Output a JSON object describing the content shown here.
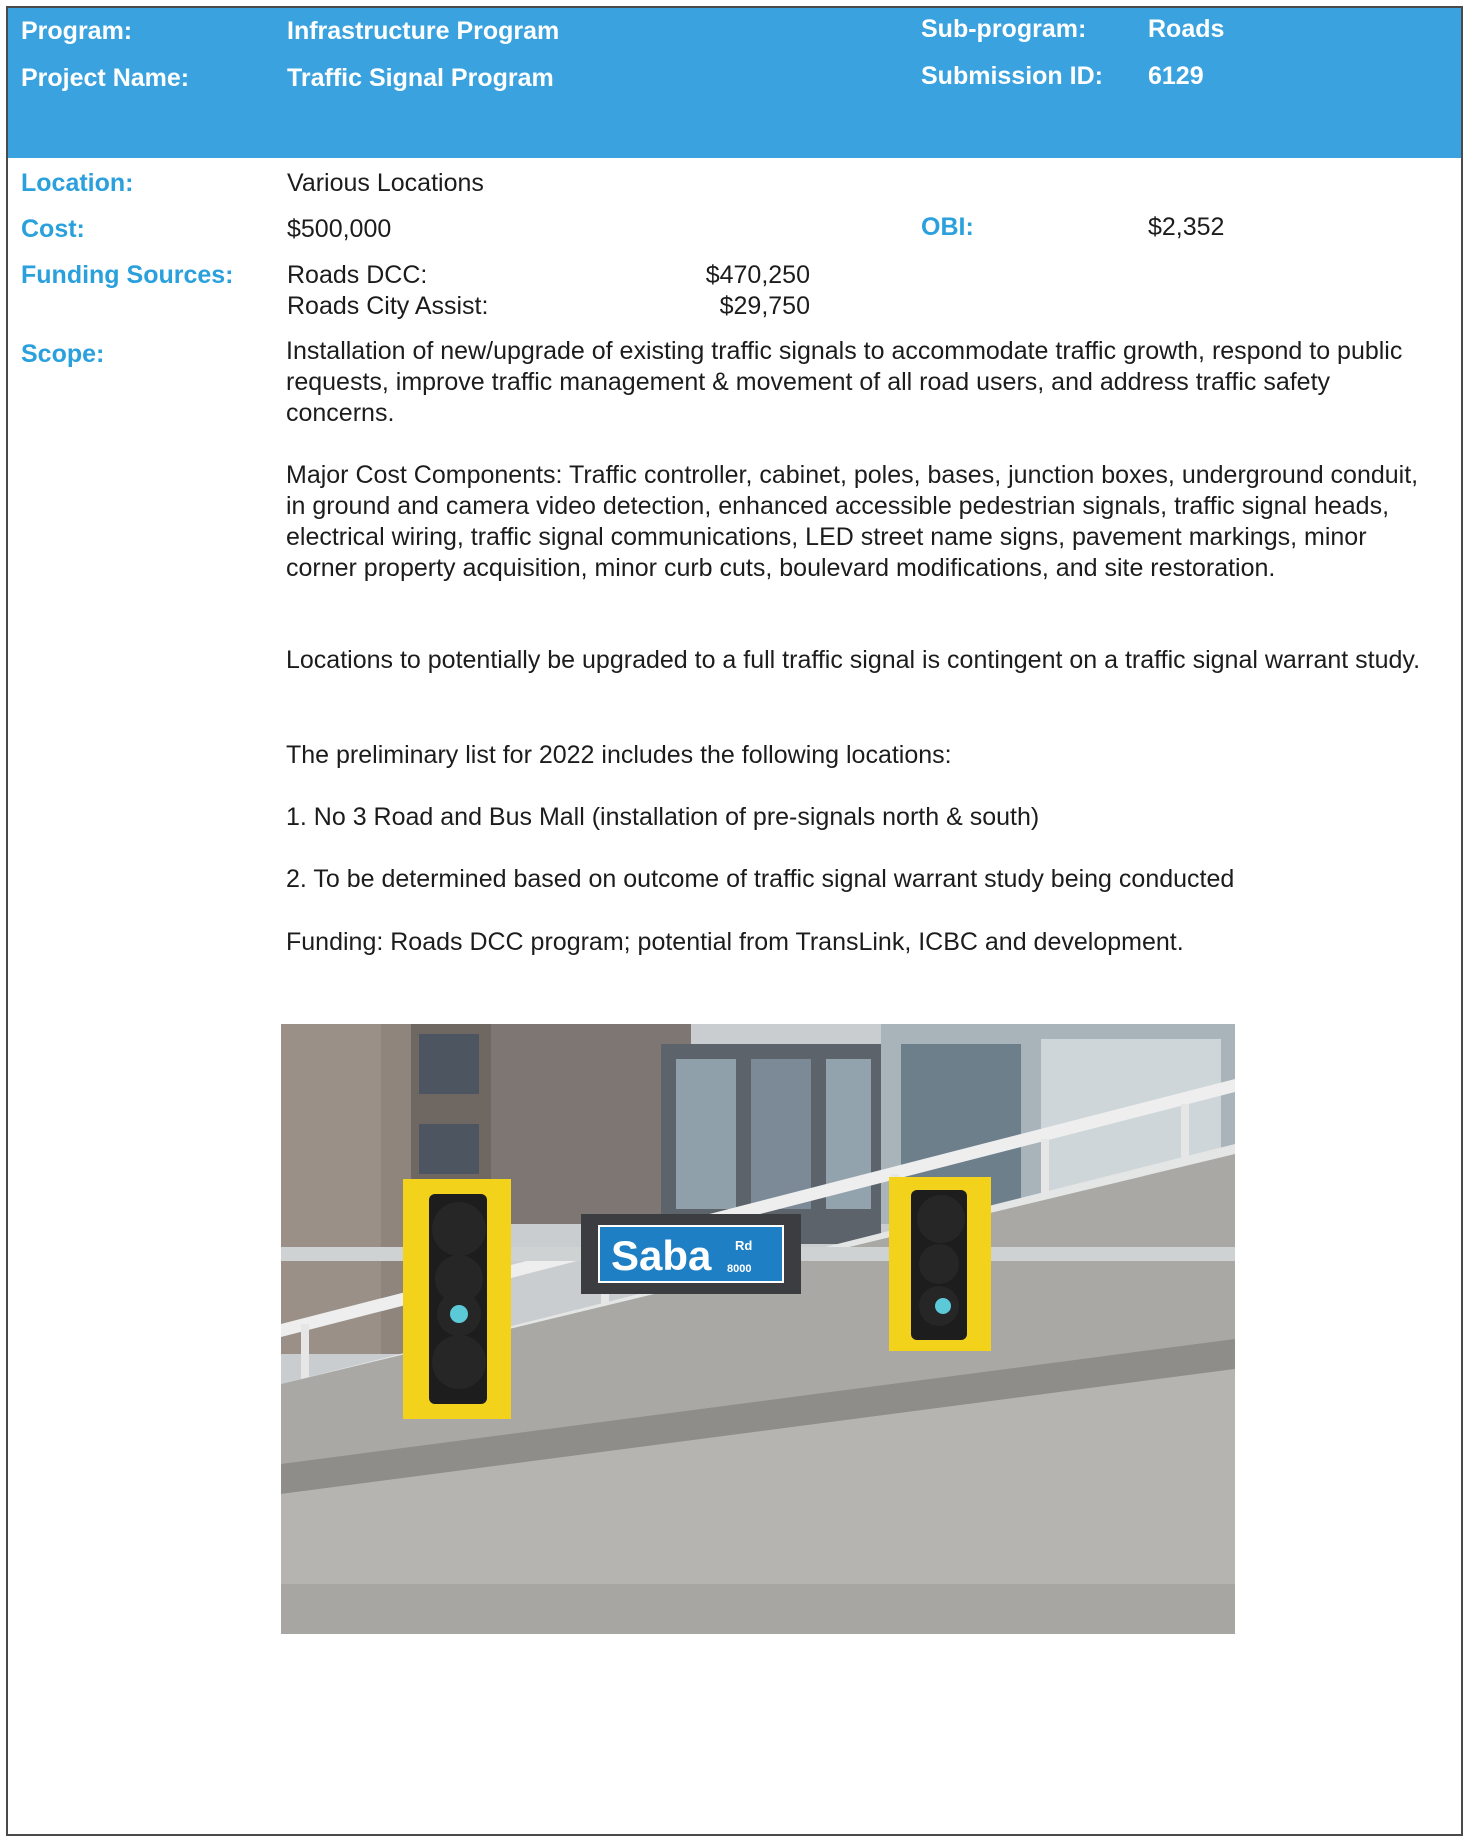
{
  "header": {
    "program_label": "Program:",
    "program_value": "Infrastructure Program",
    "subprogram_label": "Sub-program:",
    "subprogram_value": "Roads",
    "project_label": "Project Name:",
    "project_value": "Traffic Signal Program",
    "submission_label": "Submission ID:",
    "submission_value": "6129"
  },
  "details": {
    "location_label": "Location:",
    "location_value": "Various Locations",
    "cost_label": "Cost:",
    "cost_value": "$500,000",
    "obi_label": "OBI:",
    "obi_value": "$2,352",
    "funding_label": "Funding Sources:",
    "funding": [
      {
        "name": "Roads DCC:",
        "amount": "$470,250"
      },
      {
        "name": "Roads City Assist:",
        "amount": "$29,750"
      }
    ],
    "scope_label": "Scope:"
  },
  "scope": {
    "p1": "Installation of new/upgrade of existing traffic signals to accommodate traffic growth, respond to public requests, improve traffic management & movement of all road users, and address traffic safety concerns.",
    "p2": "Major Cost Components: Traffic controller, cabinet, poles, bases, junction boxes, underground conduit, in ground and camera video detection, enhanced accessible pedestrian signals, traffic signal heads, electrical wiring, traffic signal communications, LED street name signs, pavement markings, minor corner property acquisition, minor curb cuts, boulevard modifications, and site restoration.",
    "p3": "Locations to potentially be upgraded to a full traffic signal is contingent on a traffic signal warrant study.",
    "p4": "The preliminary list for 2022 includes the following locations:",
    "item1": "1. No 3 Road and Bus Mall (installation of pre-signals north & south)",
    "item2": "2. To be determined based on outcome of traffic signal warrant study being conducted",
    "p5": "Funding: Roads DCC program; potential from TransLink, ICBC and development."
  },
  "photo": {
    "sign_name": "Saba",
    "sign_suffix": "Rd",
    "sign_number": "8000"
  }
}
